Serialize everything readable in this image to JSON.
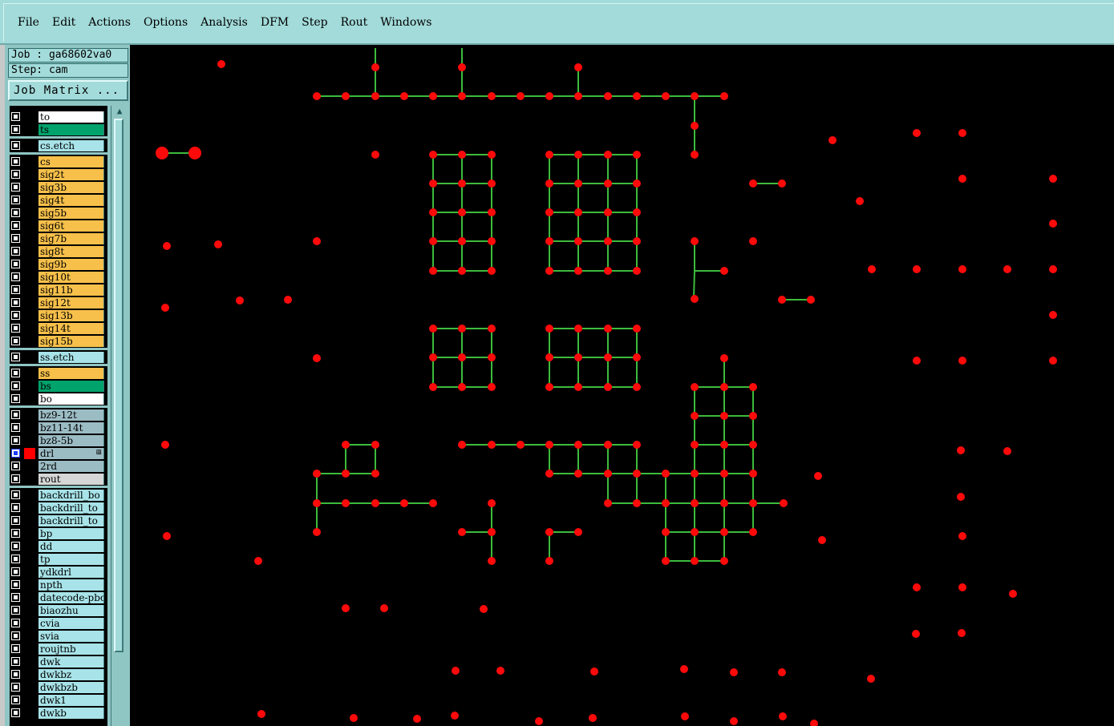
{
  "menu": [
    "File",
    "Edit",
    "Actions",
    "Options",
    "Analysis",
    "DFM",
    "Step",
    "Rout",
    "Windows"
  ],
  "job_label": "Job : ga68602va0",
  "step_label": "Step: cam",
  "job_matrix_label": "Job Matrix ...",
  "colors": {
    "signal": "#f7c04a",
    "solder": "#00a36c",
    "white": "#ffffff",
    "drill_group": "#9cbcc4",
    "misc": "#a7e3e8",
    "rout": "#d6d6d6",
    "trace": "#3dbb3d",
    "pad": "#ff0a0a",
    "active_layer": "#ff0000"
  },
  "layers": [
    {
      "name": "to",
      "color": "white"
    },
    {
      "name": "ts",
      "color": "solder"
    },
    {
      "name": "cs.etch",
      "color": "misc",
      "sep": true
    },
    {
      "name": "cs",
      "color": "signal",
      "sep": true
    },
    {
      "name": "sig2t",
      "color": "signal"
    },
    {
      "name": "sig3b",
      "color": "signal"
    },
    {
      "name": "sig4t",
      "color": "signal"
    },
    {
      "name": "sig5b",
      "color": "signal"
    },
    {
      "name": "sig6t",
      "color": "signal"
    },
    {
      "name": "sig7b",
      "color": "signal"
    },
    {
      "name": "sig8t",
      "color": "signal"
    },
    {
      "name": "sig9b",
      "color": "signal"
    },
    {
      "name": "sig10t",
      "color": "signal"
    },
    {
      "name": "sig11b",
      "color": "signal"
    },
    {
      "name": "sig12t",
      "color": "signal"
    },
    {
      "name": "sig13b",
      "color": "signal"
    },
    {
      "name": "sig14t",
      "color": "signal"
    },
    {
      "name": "sig15b",
      "color": "signal"
    },
    {
      "name": "ss.etch",
      "color": "misc",
      "sep": true
    },
    {
      "name": "ss",
      "color": "signal",
      "sep": true
    },
    {
      "name": "bs",
      "color": "solder"
    },
    {
      "name": "bo",
      "color": "white"
    },
    {
      "name": "bz9-12t",
      "color": "drill_group",
      "sep": true
    },
    {
      "name": "bz11-14t",
      "color": "drill_group"
    },
    {
      "name": "bz8-5b",
      "color": "drill_group"
    },
    {
      "name": "drl",
      "color": "drill_group",
      "active": true
    },
    {
      "name": "2rd",
      "color": "drill_group"
    },
    {
      "name": "rout",
      "color": "rout"
    },
    {
      "name": "backdrill_bo",
      "color": "misc",
      "sep": true
    },
    {
      "name": "backdrill_to",
      "color": "misc"
    },
    {
      "name": "backdrill_to",
      "color": "misc"
    },
    {
      "name": "bp",
      "color": "misc"
    },
    {
      "name": "dd",
      "color": "misc"
    },
    {
      "name": "tp",
      "color": "misc"
    },
    {
      "name": "ydkdrl",
      "color": "misc"
    },
    {
      "name": "npth",
      "color": "misc"
    },
    {
      "name": "datecode-pbo",
      "color": "misc"
    },
    {
      "name": "biaozhu",
      "color": "misc"
    },
    {
      "name": "cvia",
      "color": "misc"
    },
    {
      "name": "svia",
      "color": "misc"
    },
    {
      "name": "roujtnb",
      "color": "misc"
    },
    {
      "name": "dwk",
      "color": "misc"
    },
    {
      "name": "dwkbz",
      "color": "misc"
    },
    {
      "name": "dwkbzb",
      "color": "misc"
    },
    {
      "name": "dwk1",
      "color": "misc"
    },
    {
      "name": "dwkb",
      "color": "misc"
    }
  ]
}
